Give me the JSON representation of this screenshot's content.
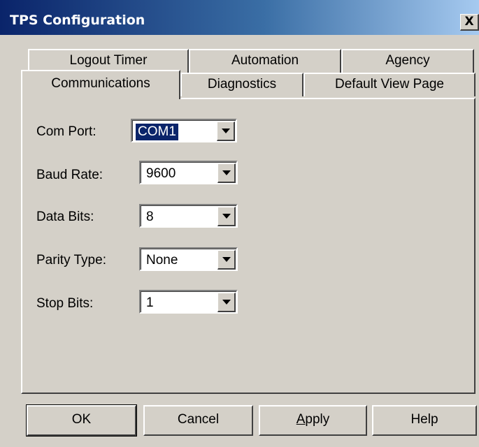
{
  "window": {
    "title": "TPS Configuration",
    "close_label": "X"
  },
  "tabs": {
    "row1": [
      {
        "label": "Logout Timer"
      },
      {
        "label": "Automation"
      },
      {
        "label": "Agency"
      }
    ],
    "row2": [
      {
        "label": "Communications",
        "active": true
      },
      {
        "label": "Diagnostics"
      },
      {
        "label": "Default View Page"
      }
    ]
  },
  "fields": [
    {
      "label": "Com Port:",
      "value": "COM1",
      "focused": true
    },
    {
      "label": "Baud Rate:",
      "value": "9600"
    },
    {
      "label": "Data Bits:",
      "value": "8"
    },
    {
      "label": "Parity Type:",
      "value": "None"
    },
    {
      "label": "Stop Bits:",
      "value": "1"
    }
  ],
  "buttons": {
    "ok": "OK",
    "cancel": "Cancel",
    "apply": "Apply",
    "help": "Help"
  },
  "icons": {
    "close": "close-icon",
    "dropdown": "chevron-down-icon"
  },
  "colors": {
    "title_start": "#0a246a",
    "title_end": "#a6caf0",
    "selection": "#0a246a",
    "face": "#d4d0c8"
  }
}
